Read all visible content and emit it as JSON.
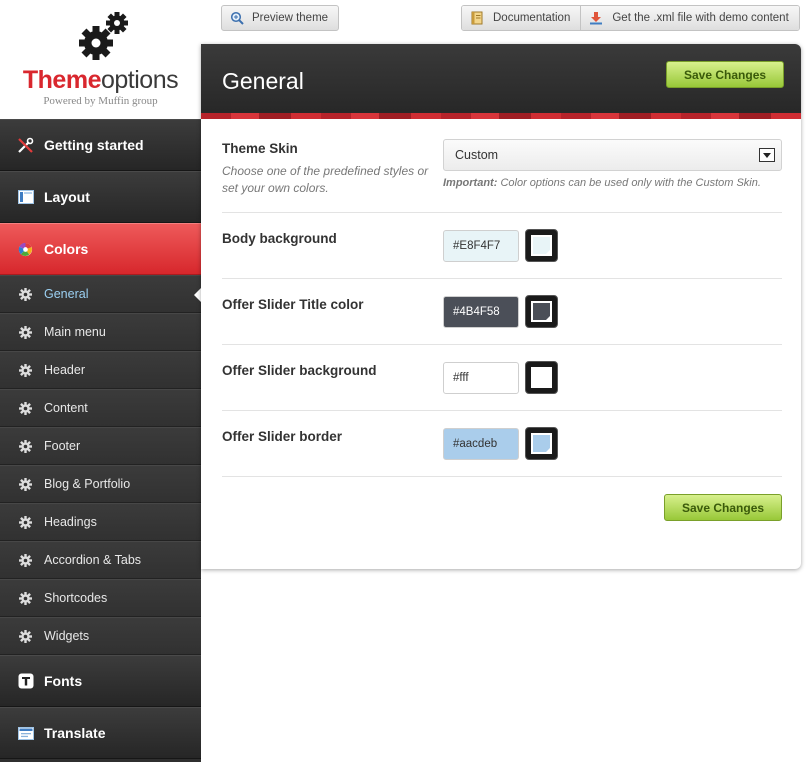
{
  "logo": {
    "brand_part1": "Theme",
    "brand_part2": "options",
    "powered_by": "Powered by Muffin group",
    "icon": "gears-icon"
  },
  "toolbar": {
    "preview_label": "Preview theme",
    "documentation_label": "Documentation",
    "xml_label": "Get the .xml file with demo content"
  },
  "sidebar": {
    "main_items": [
      {
        "label": "Getting started",
        "icon": "tools-icon"
      },
      {
        "label": "Layout",
        "icon": "layout-icon"
      },
      {
        "label": "Colors",
        "icon": "palette-icon",
        "active": true
      },
      {
        "label": "Fonts",
        "icon": "font-icon"
      },
      {
        "label": "Translate",
        "icon": "translate-icon"
      }
    ],
    "sub_items": [
      {
        "label": "General",
        "active": true
      },
      {
        "label": "Main menu"
      },
      {
        "label": "Header"
      },
      {
        "label": "Content"
      },
      {
        "label": "Footer"
      },
      {
        "label": "Blog & Portfolio"
      },
      {
        "label": "Headings"
      },
      {
        "label": "Accordion & Tabs"
      },
      {
        "label": "Shortcodes"
      },
      {
        "label": "Widgets"
      }
    ]
  },
  "panel": {
    "title": "General",
    "save_label": "Save Changes",
    "skin": {
      "label": "Theme Skin",
      "description": "Choose one of the predefined styles or set your own colors.",
      "value": "Custom",
      "important_label": "Important:",
      "important_text": "Color options can be used only with the Custom Skin."
    },
    "colors": [
      {
        "label": "Body background",
        "value": "#E8F4F7",
        "swatch": "#e8f4f7",
        "text_color": "#333333"
      },
      {
        "label": "Offer Slider Title color",
        "value": "#4B4F58",
        "swatch": "#4b4f58",
        "text_color": "#ffffff"
      },
      {
        "label": "Offer Slider background",
        "value": "#fff",
        "swatch": "#ffffff",
        "text_color": "#333333"
      },
      {
        "label": "Offer Slider border",
        "value": "#aacdeb",
        "swatch": "#aacdeb",
        "text_color": "#333333"
      }
    ]
  }
}
